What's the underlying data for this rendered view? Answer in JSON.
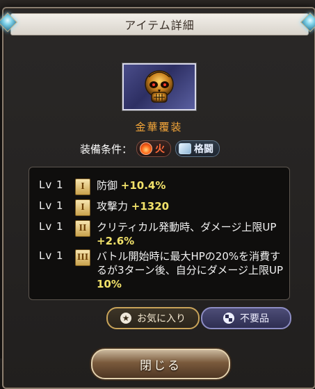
{
  "dialog": {
    "title": "アイテム詳細"
  },
  "item": {
    "name": "金華覆装",
    "icon": "golden-skull-mask-icon",
    "equip_label": "装備条件：",
    "conditions": [
      {
        "icon": "fire-element-icon",
        "label": "火",
        "color": "#ff6a3a"
      },
      {
        "icon": "fist-icon",
        "label": "格闘",
        "color": "#e8f0ff"
      }
    ]
  },
  "skills": [
    {
      "lv": "Lv 1",
      "rank": "I",
      "text": "防御 ",
      "value": "+10.4%"
    },
    {
      "lv": "Lv 1",
      "rank": "I",
      "text": "攻撃力 ",
      "value": "+1320"
    },
    {
      "lv": "Lv 1",
      "rank": "II",
      "text": "クリティカル発動時、ダメージ上限UP ",
      "value": "+2.6%"
    },
    {
      "lv": "Lv 1",
      "rank": "III",
      "text": "バトル開始時に最大HPの20%を消費するが3ターン後、自分にダメージ上限UP ",
      "value": "10%"
    }
  ],
  "buttons": {
    "favorite": "お気に入り",
    "junk": "不要品",
    "close": "閉じる"
  },
  "colors": {
    "accent_orange": "#f4a63a",
    "value_yellow": "#f2e26a",
    "fav_border": "#c9a45a",
    "junk_border": "#8d8dc4"
  }
}
